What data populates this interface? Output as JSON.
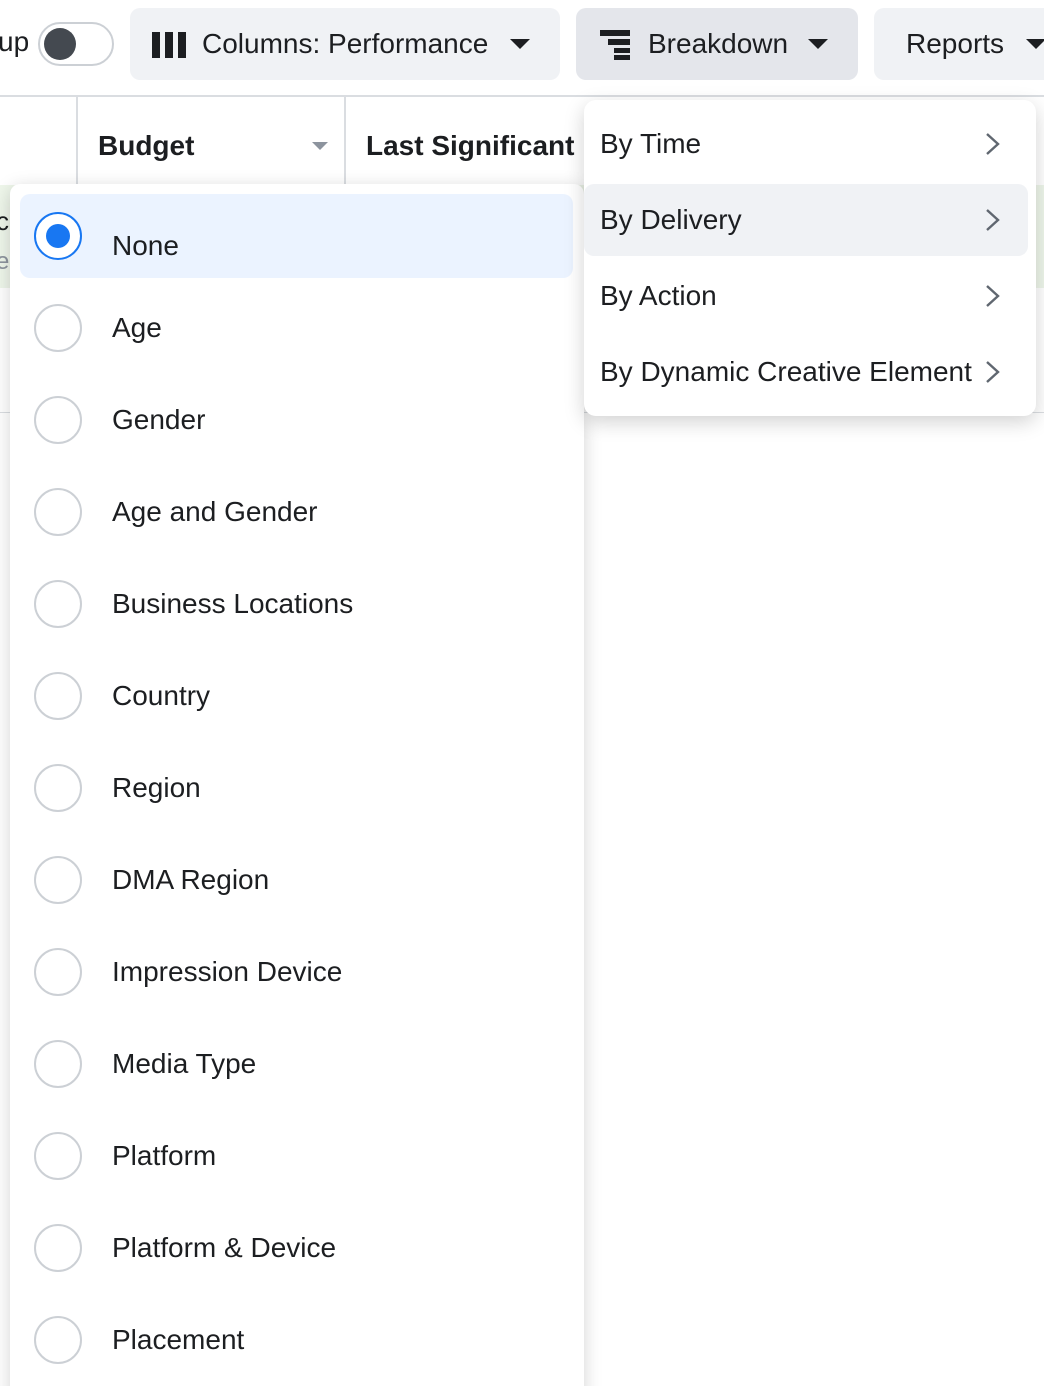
{
  "toolbar": {
    "toggle_label": "up",
    "columns_label": "Columns: Performance",
    "breakdown_label": "Breakdown",
    "reports_label": "Reports"
  },
  "table": {
    "headers": [
      "Budget",
      "Last Significant E"
    ],
    "strip_letters": [
      "c",
      "e"
    ]
  },
  "breakdown_submenu": {
    "items": [
      "By Time",
      "By Delivery",
      "By Action",
      "By Dynamic Creative Element"
    ],
    "highlighted": "By Delivery"
  },
  "delivery_options": {
    "selected": "None",
    "items": [
      "None",
      "Age",
      "Gender",
      "Age and Gender",
      "Business Locations",
      "Country",
      "Region",
      "DMA Region",
      "Impression Device",
      "Media Type",
      "Platform",
      "Platform & Device",
      "Placement"
    ]
  },
  "colors": {
    "accent": "#1877f2",
    "selected_bg": "#ebf3ff",
    "hover_bg": "#f0f2f5",
    "strip_bg": "#eef6ea"
  },
  "icons": {
    "columns": "columns-icon",
    "breakdown": "breakdown-icon",
    "chevron": "chevron-right-icon",
    "caret": "caret-down-icon"
  }
}
